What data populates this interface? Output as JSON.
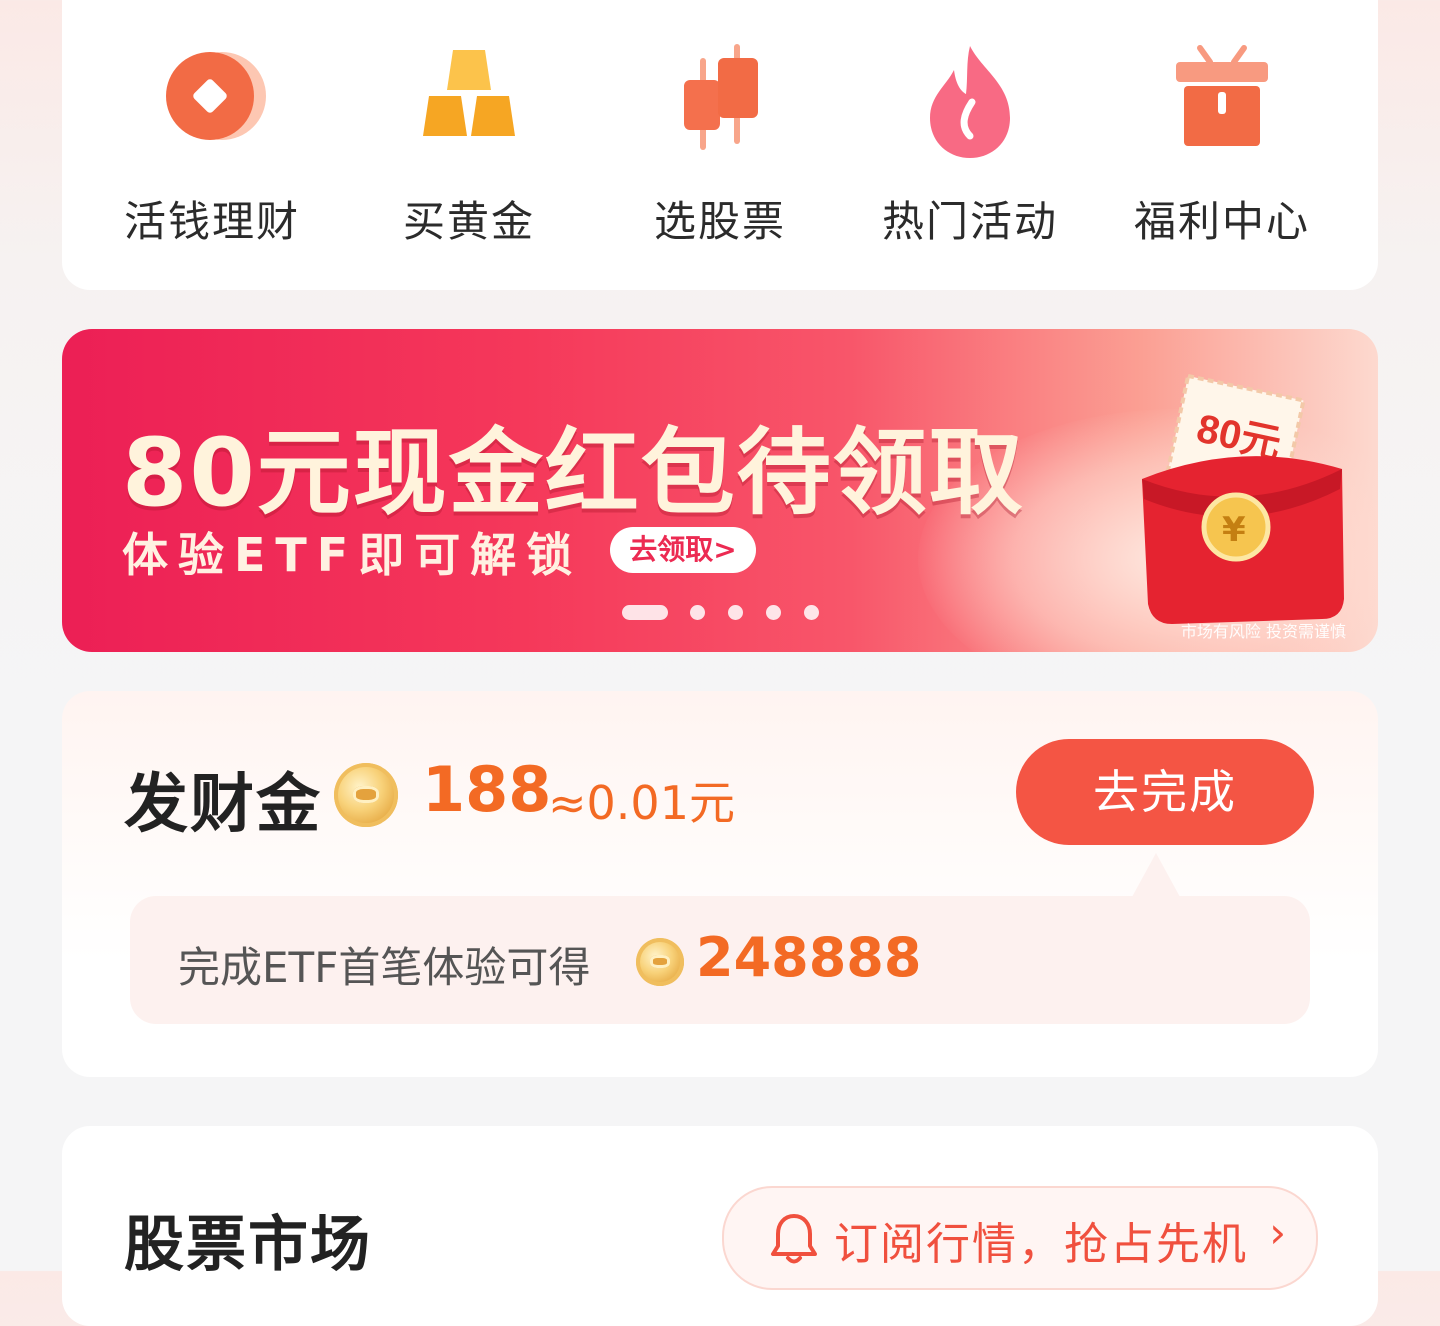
{
  "quick_nav": {
    "items": [
      {
        "label": "活钱理财",
        "icon": "coin-icon"
      },
      {
        "label": "买黄金",
        "icon": "gold-bars-icon"
      },
      {
        "label": "选股票",
        "icon": "candlestick-icon"
      },
      {
        "label": "热门活动",
        "icon": "flame-icon"
      },
      {
        "label": "福利中心",
        "icon": "gift-icon"
      }
    ]
  },
  "banner": {
    "title": "80元现金红包待领取",
    "subtitle": "体验ETF即可解锁",
    "cta": "去领取>",
    "envelope_ticket": "80元",
    "risk_note": "市场有风险 投资需谨慎",
    "slide_count": 5,
    "active_slide": 1
  },
  "fortune": {
    "title": "发财金",
    "amount": "188",
    "approx_value": "≈0.01元",
    "button": "去完成",
    "tip_text": "完成ETF首笔体验可得",
    "tip_amount": "248888"
  },
  "market": {
    "title": "股票市场",
    "subscribe_text": "订阅行情，抢占先机",
    "subscribe_chevron": "›"
  },
  "colors": {
    "accent": "#f45544",
    "amount": "#f36a24",
    "banner_start": "#ec1f55"
  }
}
